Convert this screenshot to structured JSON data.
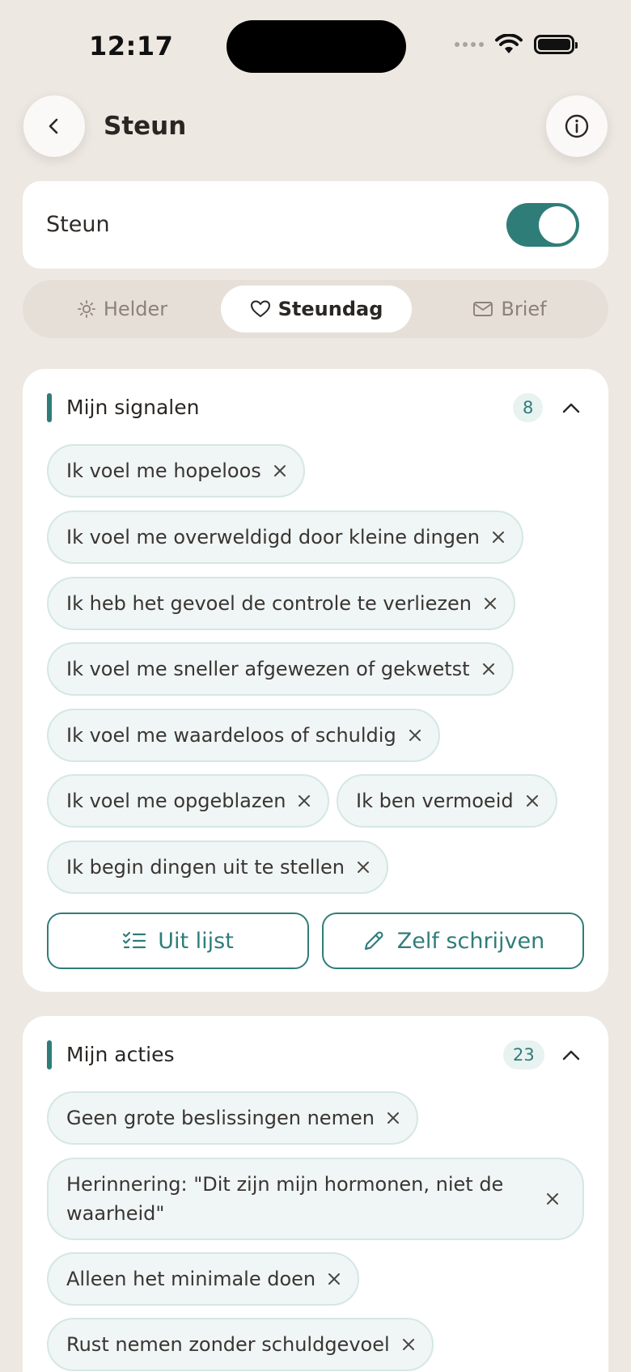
{
  "status_bar": {
    "time": "12:17"
  },
  "header": {
    "title": "Steun"
  },
  "toggle": {
    "label": "Steun",
    "on": true
  },
  "tabs": [
    {
      "label": "Helder",
      "icon": "sun-icon",
      "selected": false
    },
    {
      "label": "Steundag",
      "icon": "heart-icon",
      "selected": true
    },
    {
      "label": "Brief",
      "icon": "mail-icon",
      "selected": false
    }
  ],
  "signalen": {
    "title": "Mijn signalen",
    "count": "8",
    "items": [
      "Ik voel me hopeloos",
      "Ik voel me overweldigd door kleine dingen",
      "Ik heb het gevoel de controle te verliezen",
      "Ik voel me sneller afgewezen of gekwetst",
      "Ik voel me waardeloos of schuldig",
      "Ik voel me opgeblazen",
      "Ik ben vermoeid",
      "Ik begin dingen uit te stellen"
    ],
    "btn_list": "Uit lijst",
    "btn_write": "Zelf schrijven"
  },
  "acties": {
    "title": "Mijn acties",
    "count": "23",
    "items": [
      "Geen grote beslissingen nemen",
      "Herinnering: \"Dit zijn mijn hormonen, niet de waarheid\"",
      "Alleen het minimale doen",
      "Rust nemen zonder schuldgevoel"
    ]
  },
  "colors": {
    "accent": "#2F7D79",
    "background": "#EEE8E2",
    "chip_bg": "#EFF6F5"
  }
}
